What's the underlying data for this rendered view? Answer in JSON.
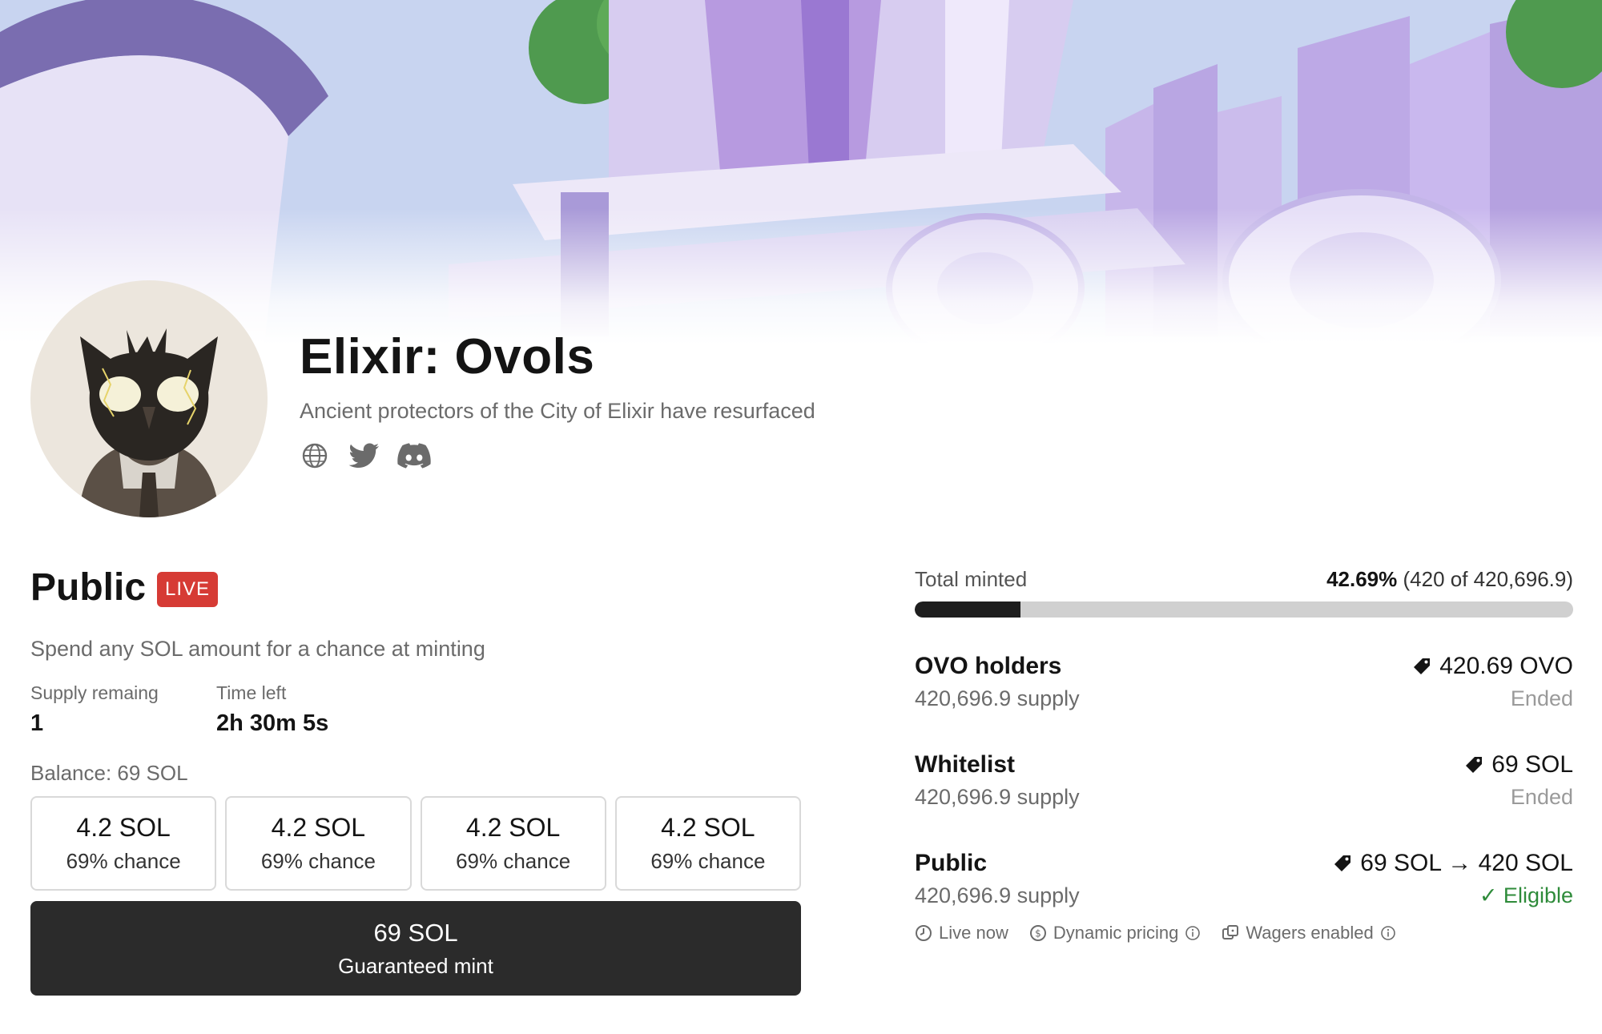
{
  "collection": {
    "title": "Elixir: Ovols",
    "subtitle": "Ancient protectors of the City of Elixir have resurfaced",
    "socials": [
      {
        "icon": "globe-icon"
      },
      {
        "icon": "twitter-icon"
      },
      {
        "icon": "discord-icon"
      }
    ]
  },
  "mint": {
    "phase": "Public",
    "live_label": "LIVE",
    "description": "Spend any SOL amount for a chance at minting",
    "stats": [
      {
        "label": "Supply remaing",
        "value": "1"
      },
      {
        "label": "Time left",
        "value": "2h 30m 5s"
      }
    ],
    "balance": "Balance: 69 SOL",
    "options": [
      {
        "amount": "4.2 SOL",
        "chance": "69% chance"
      },
      {
        "amount": "4.2 SOL",
        "chance": "69% chance"
      },
      {
        "amount": "4.2 SOL",
        "chance": "69% chance"
      },
      {
        "amount": "4.2 SOL",
        "chance": "69% chance"
      }
    ],
    "guaranteed": {
      "amount": "69 SOL",
      "label": "Guaranteed mint"
    }
  },
  "progress": {
    "label": "Total minted",
    "percent": "42.69%",
    "detail": "(420 of 420,696.9)",
    "fill_fraction": 0.16
  },
  "phases": [
    {
      "name": "OVO holders",
      "supply": "420,696.9 supply",
      "price": "420.69 OVO",
      "status": "Ended"
    },
    {
      "name": "Whitelist",
      "supply": "420,696.9 supply",
      "price": "69 SOL",
      "status": "Ended"
    },
    {
      "name": "Public",
      "supply": "420,696.9 supply",
      "price": "69 SOL → 420 SOL",
      "status": "✓ Eligible"
    }
  ],
  "tags": [
    {
      "icon": "clock-icon",
      "label": "Live now"
    },
    {
      "icon": "coin-icon",
      "label": "Dynamic pricing"
    },
    {
      "icon": "wager-icon",
      "label": "Wagers enabled"
    }
  ],
  "colors": {
    "live": "#d63b35",
    "eligible": "#2e8b3a",
    "primary_button": "#2b2b2b"
  }
}
